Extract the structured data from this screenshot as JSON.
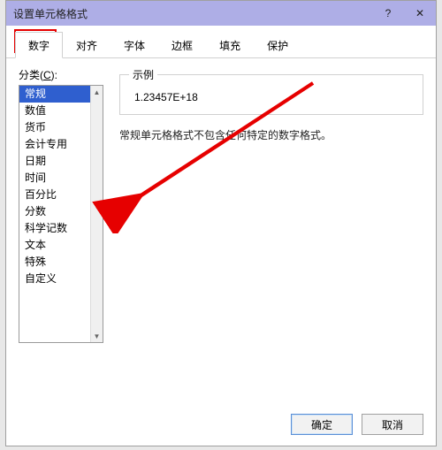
{
  "title": "设置单元格格式",
  "titlebar": {
    "help": "?",
    "close": "✕"
  },
  "tabs": [
    "数字",
    "对齐",
    "字体",
    "边框",
    "填充",
    "保护"
  ],
  "active_tab_index": 0,
  "category_label_pre": "分类(",
  "category_label_key": "C",
  "category_label_post": "):",
  "categories": [
    "常规",
    "数值",
    "货币",
    "会计专用",
    "日期",
    "时间",
    "百分比",
    "分数",
    "科学记数",
    "文本",
    "特殊",
    "自定义"
  ],
  "selected_category_index": 0,
  "sample": {
    "label": "示例",
    "value": "1.23457E+18"
  },
  "description": "常规单元格格式不包含任何特定的数字格式。",
  "buttons": {
    "ok": "确定",
    "cancel": "取消"
  }
}
